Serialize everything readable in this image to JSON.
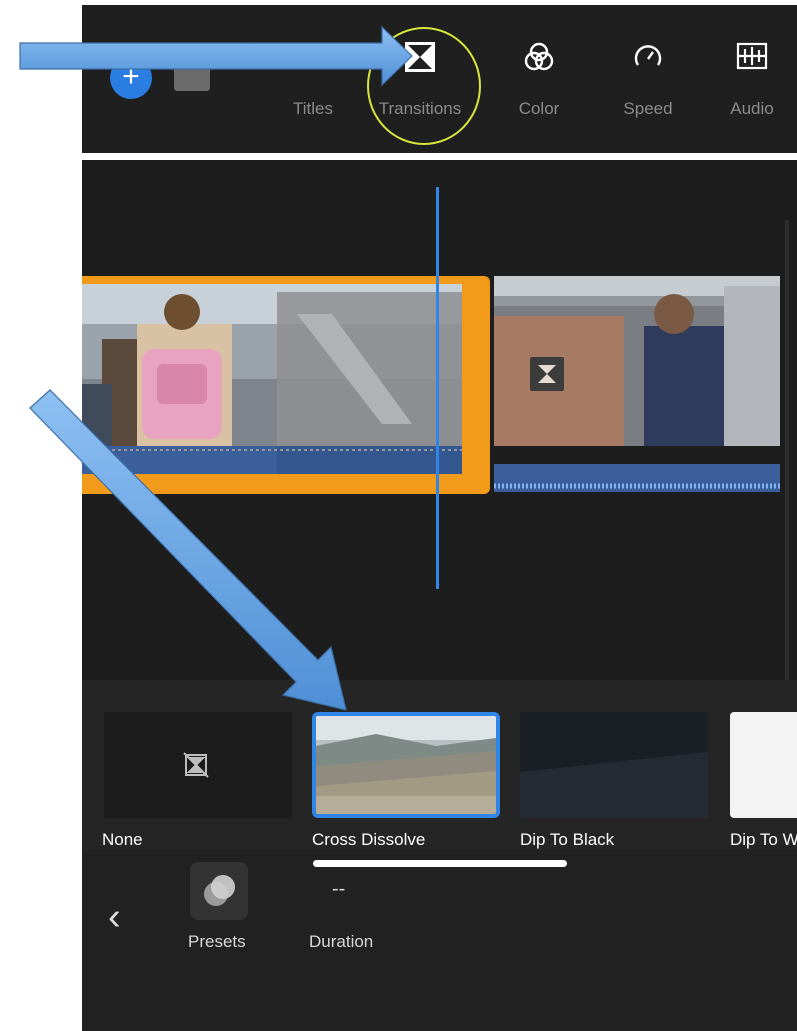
{
  "toolbar": {
    "tools": [
      {
        "label": "Titles",
        "icon": "titles-icon"
      },
      {
        "label": "Transitions",
        "icon": "transitions-icon"
      },
      {
        "label": "Color",
        "icon": "color-icon"
      },
      {
        "label": "Speed",
        "icon": "speed-icon"
      },
      {
        "label": "Audio",
        "icon": "audio-icon"
      }
    ],
    "add_label": "+",
    "highlight_color": "#d8e63a"
  },
  "timeline": {
    "clip_accent": "#f29a1a",
    "playhead_color": "#2f86e6"
  },
  "transitions": {
    "presets": [
      {
        "name": "None"
      },
      {
        "name": "Cross Dissolve"
      },
      {
        "name": "Dip To Black"
      },
      {
        "name": "Dip To W"
      }
    ],
    "selected": "Cross Dissolve",
    "selection_color": "#2f86e6"
  },
  "options": {
    "back_label": "‹",
    "presets_label": "Presets",
    "duration_label": "Duration",
    "duration_value": "--"
  },
  "annotation": {
    "arrow_color": "#6ea8e6"
  }
}
